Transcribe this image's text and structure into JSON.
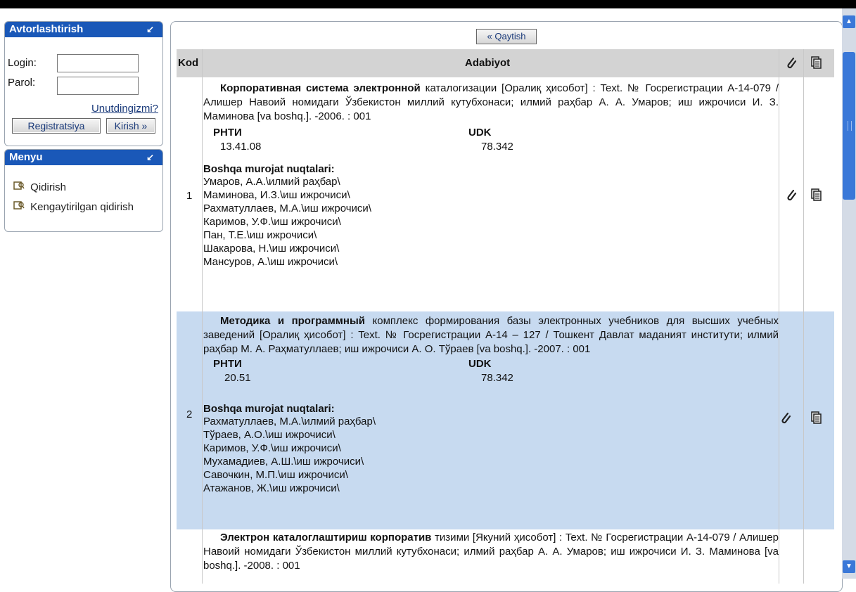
{
  "auth": {
    "title": "Avtorlashtirish",
    "collapse_glyph": "↙",
    "login_label": "Login:",
    "login_value": "",
    "password_label": "Parol:",
    "password_value": "",
    "forgot_link": "Unutdingizmi?",
    "register_button": "Registratsiya",
    "login_button": "Kirish »"
  },
  "menu": {
    "title": "Menyu",
    "collapse_glyph": "↙",
    "items": [
      {
        "label": "Qidirish",
        "icon": "search-book-icon"
      },
      {
        "label": "Kengaytirilgan qidirish",
        "icon": "search-book-icon"
      }
    ]
  },
  "main": {
    "back_button": "« Qaytish",
    "columns": {
      "kod": "Kod",
      "adabiyot": "Adabiyot"
    },
    "header_icons": [
      "attachment-icon",
      "copy-icon"
    ],
    "records": [
      {
        "kod": "1",
        "bold_lead": "Корпоративная система электронной",
        "description": " каталогизации [Оралиқ ҳисобот] : Text. № Госрегистрации А-14-079 / Алишер Навоий номидаги Ўзбекистон миллий кутубхонаси; илмий раҳбар А. А. Умаров; иш ижрочиси И. З. Маминова [va boshq.]. -2006. : 001",
        "rnti_label": "РНТИ",
        "rnti_value": "13.41.08",
        "udk_label": "UDK",
        "udk_value": "78.342",
        "other_points_title": "Boshqa murojat nuqtalari:",
        "other_points": [
          "Умаров, А.А.\\илмий раҳбар\\",
          "Маминова, И.З.\\иш ижрочиси\\",
          "Рахматуллаев, М.А.\\иш ижрочиси\\",
          "Каримов, У.Ф.\\иш ижрочиси\\",
          "Пан, Т.Е.\\иш ижрочиси\\",
          "Шакарова, Н.\\иш ижрочиси\\",
          "Мансуров, А.\\иш ижрочиси\\"
        ]
      },
      {
        "kod": "2",
        "bold_lead": "Методика и программный",
        "description": " комплекс формирования базы электронных учебников для высших учебных заведений [Оралиқ ҳисобот] : Text. № Госрегистрации А-14 – 127 / Тошкент Давлат маданият институти; илмий раҳбар М. А. Раҳматуллаев; иш ижрочиси А. О. Тўраев [va boshq.]. -2007. : 001",
        "rnti_label": "РНТИ",
        "rnti_value": "20.51",
        "udk_label": "UDK",
        "udk_value": "78.342",
        "other_points_title": "Boshqa murojat nuqtalari:",
        "other_points": [
          "Рахматуллаев, М.А.\\илмий раҳбар\\",
          "Тўраев, А.О.\\иш ижрочиси\\",
          "Каримов, У.Ф.\\иш ижрочиси\\",
          "Мухамадиев, А.Ш.\\иш ижрочиси\\",
          "Савочкин, М.П.\\иш ижрочиси\\",
          "Атажанов, Ж.\\иш ижрочиси\\"
        ]
      },
      {
        "kod": "",
        "bold_lead": "Электрон каталоглаштириш корпоратив",
        "description": " тизими [Якуний ҳисобот] : Text. № Госрегистрации А-14-079 / Алишер Навоий номидаги Ўзбекистон миллий кутубхонаси; илмий раҳбар А. А. Умаров; иш ижрочиси И. З. Маминова [va boshq.]. -2008. : 001"
      }
    ]
  }
}
